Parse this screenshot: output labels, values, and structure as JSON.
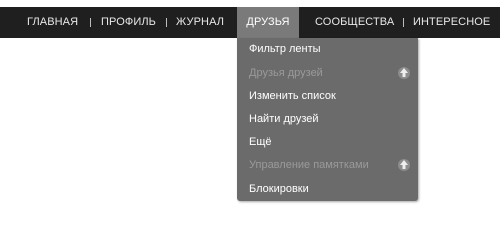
{
  "nav": {
    "items": [
      {
        "label": "ГЛАВНАЯ"
      },
      {
        "label": "ПРОФИЛЬ"
      },
      {
        "label": "ЖУРНАЛ"
      },
      {
        "label": "ДРУЗЬЯ"
      },
      {
        "label": "СООБЩЕСТВА"
      },
      {
        "label": "ИНТЕРЕСНОЕ"
      }
    ],
    "active_index": 3
  },
  "dropdown": {
    "items": [
      {
        "label": "Фильтр ленты",
        "state": "enabled"
      },
      {
        "label": "Друзья друзей",
        "state": "disabled",
        "icon": "pin-icon"
      },
      {
        "label": "Изменить список",
        "state": "enabled"
      },
      {
        "label": "Найти друзей",
        "state": "enabled"
      },
      {
        "label": "Ещё",
        "state": "enabled"
      },
      {
        "label": "Управление памятками",
        "state": "disabled",
        "icon": "pin-icon"
      },
      {
        "label": "Блокировки",
        "state": "enabled"
      }
    ]
  },
  "colors": {
    "navbar_bg": "#1f1f1f",
    "active_tab_bg": "#7a7a7a",
    "dropdown_bg": "#6b6b6b",
    "disabled_text": "#9a9a9a"
  }
}
